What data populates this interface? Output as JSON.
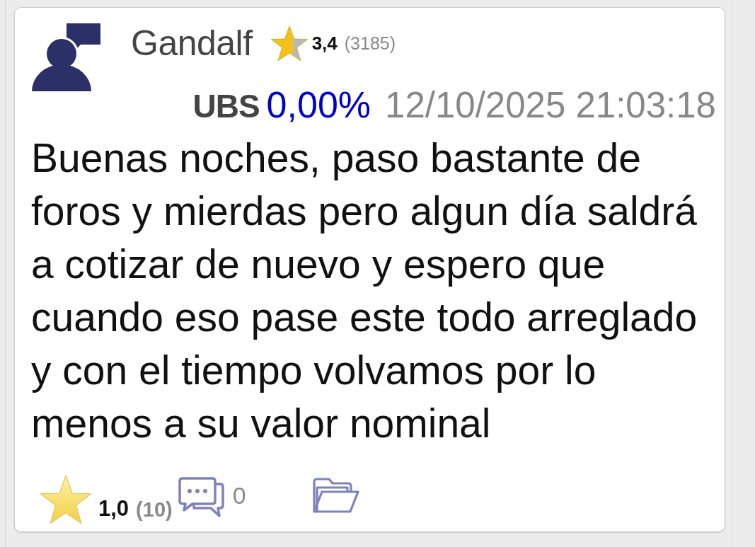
{
  "post": {
    "author": {
      "name": "Gandalf",
      "rating": "3,4",
      "rating_count": "(3185)"
    },
    "ticker": "UBS",
    "change": "0,00%",
    "timestamp": "12/10/2025 21:03:18",
    "body": "Buenas noches, paso bastante de foros y mierdas pero algun día saldrá a cotizar de nuevo y espero que cuando eso pase este todo arreglado y con el tiempo volvamos por lo menos a su valor nominal",
    "footer": {
      "rating": "1,0",
      "rating_count": "(10)",
      "comments": "0"
    }
  }
}
